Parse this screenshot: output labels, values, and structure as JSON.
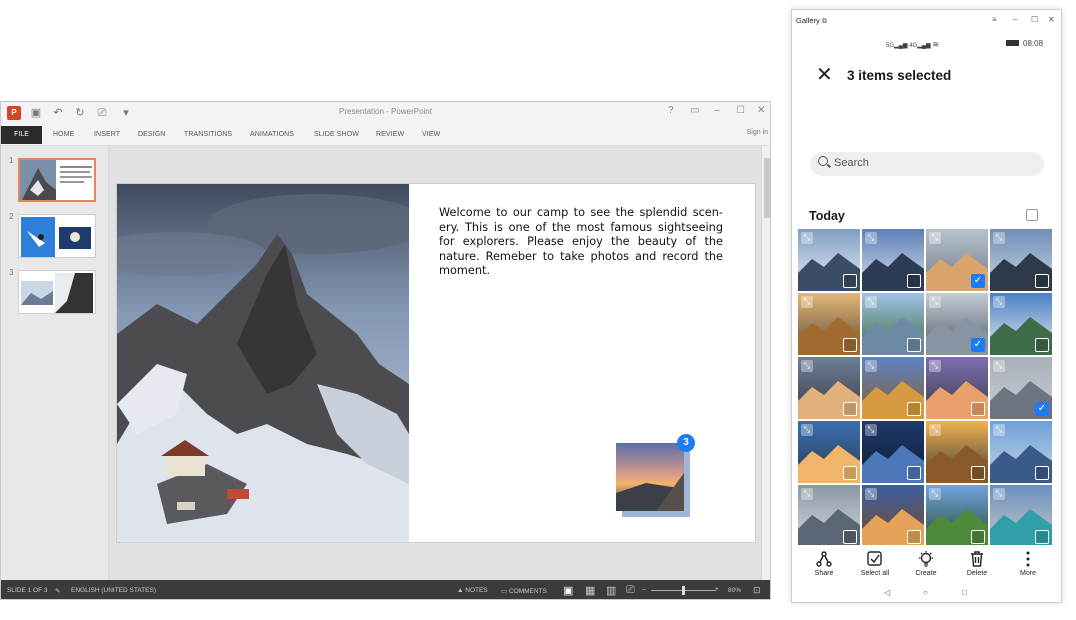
{
  "powerpoint": {
    "window_title": "Presentation - PowerPoint",
    "help": "?",
    "file_tab": "FILE",
    "tabs": [
      "HOME",
      "INSERT",
      "DESIGN",
      "TRANSITIONS",
      "ANIMATIONS",
      "SLIDE SHOW",
      "REVIEW",
      "VIEW"
    ],
    "sign_in": "Sign in",
    "slide_numbers": [
      "1",
      "2",
      "3"
    ],
    "slide_text": "Welcome to our camp to see the  splendid scen-ery. This is one of the most famous sightseeing for explorers. Please enjoy the beauty of the nature. Remeber to take photos and record the moment.",
    "drag_count": "3",
    "status": {
      "slide_of": "SLIDE 1 OF 3",
      "language": "ENGLISH (UNITED STATES)",
      "notes": "NOTES",
      "comments": "COMMENTS",
      "zoom": "80%"
    }
  },
  "gallery": {
    "window_title": "Gallery",
    "status_signal_1": "5G",
    "status_signal_2": "4G",
    "time": "08:08",
    "header_title": "3 items selected",
    "search_placeholder": "Search",
    "section_title": "Today",
    "photos": [
      {
        "checked": false
      },
      {
        "checked": false
      },
      {
        "checked": true
      },
      {
        "checked": false
      },
      {
        "checked": false
      },
      {
        "checked": false
      },
      {
        "checked": true
      },
      {
        "checked": false
      },
      {
        "checked": false
      },
      {
        "checked": false
      },
      {
        "checked": false
      },
      {
        "checked": true
      },
      {
        "checked": false
      },
      {
        "checked": false
      },
      {
        "checked": false
      },
      {
        "checked": false
      },
      {
        "checked": false
      },
      {
        "checked": false
      },
      {
        "checked": false
      },
      {
        "checked": false
      }
    ],
    "actions": {
      "share": "Share",
      "select_all": "Select all",
      "create": "Create",
      "delete": "Delete",
      "more": "More"
    },
    "accent": "#1d7cf2"
  }
}
